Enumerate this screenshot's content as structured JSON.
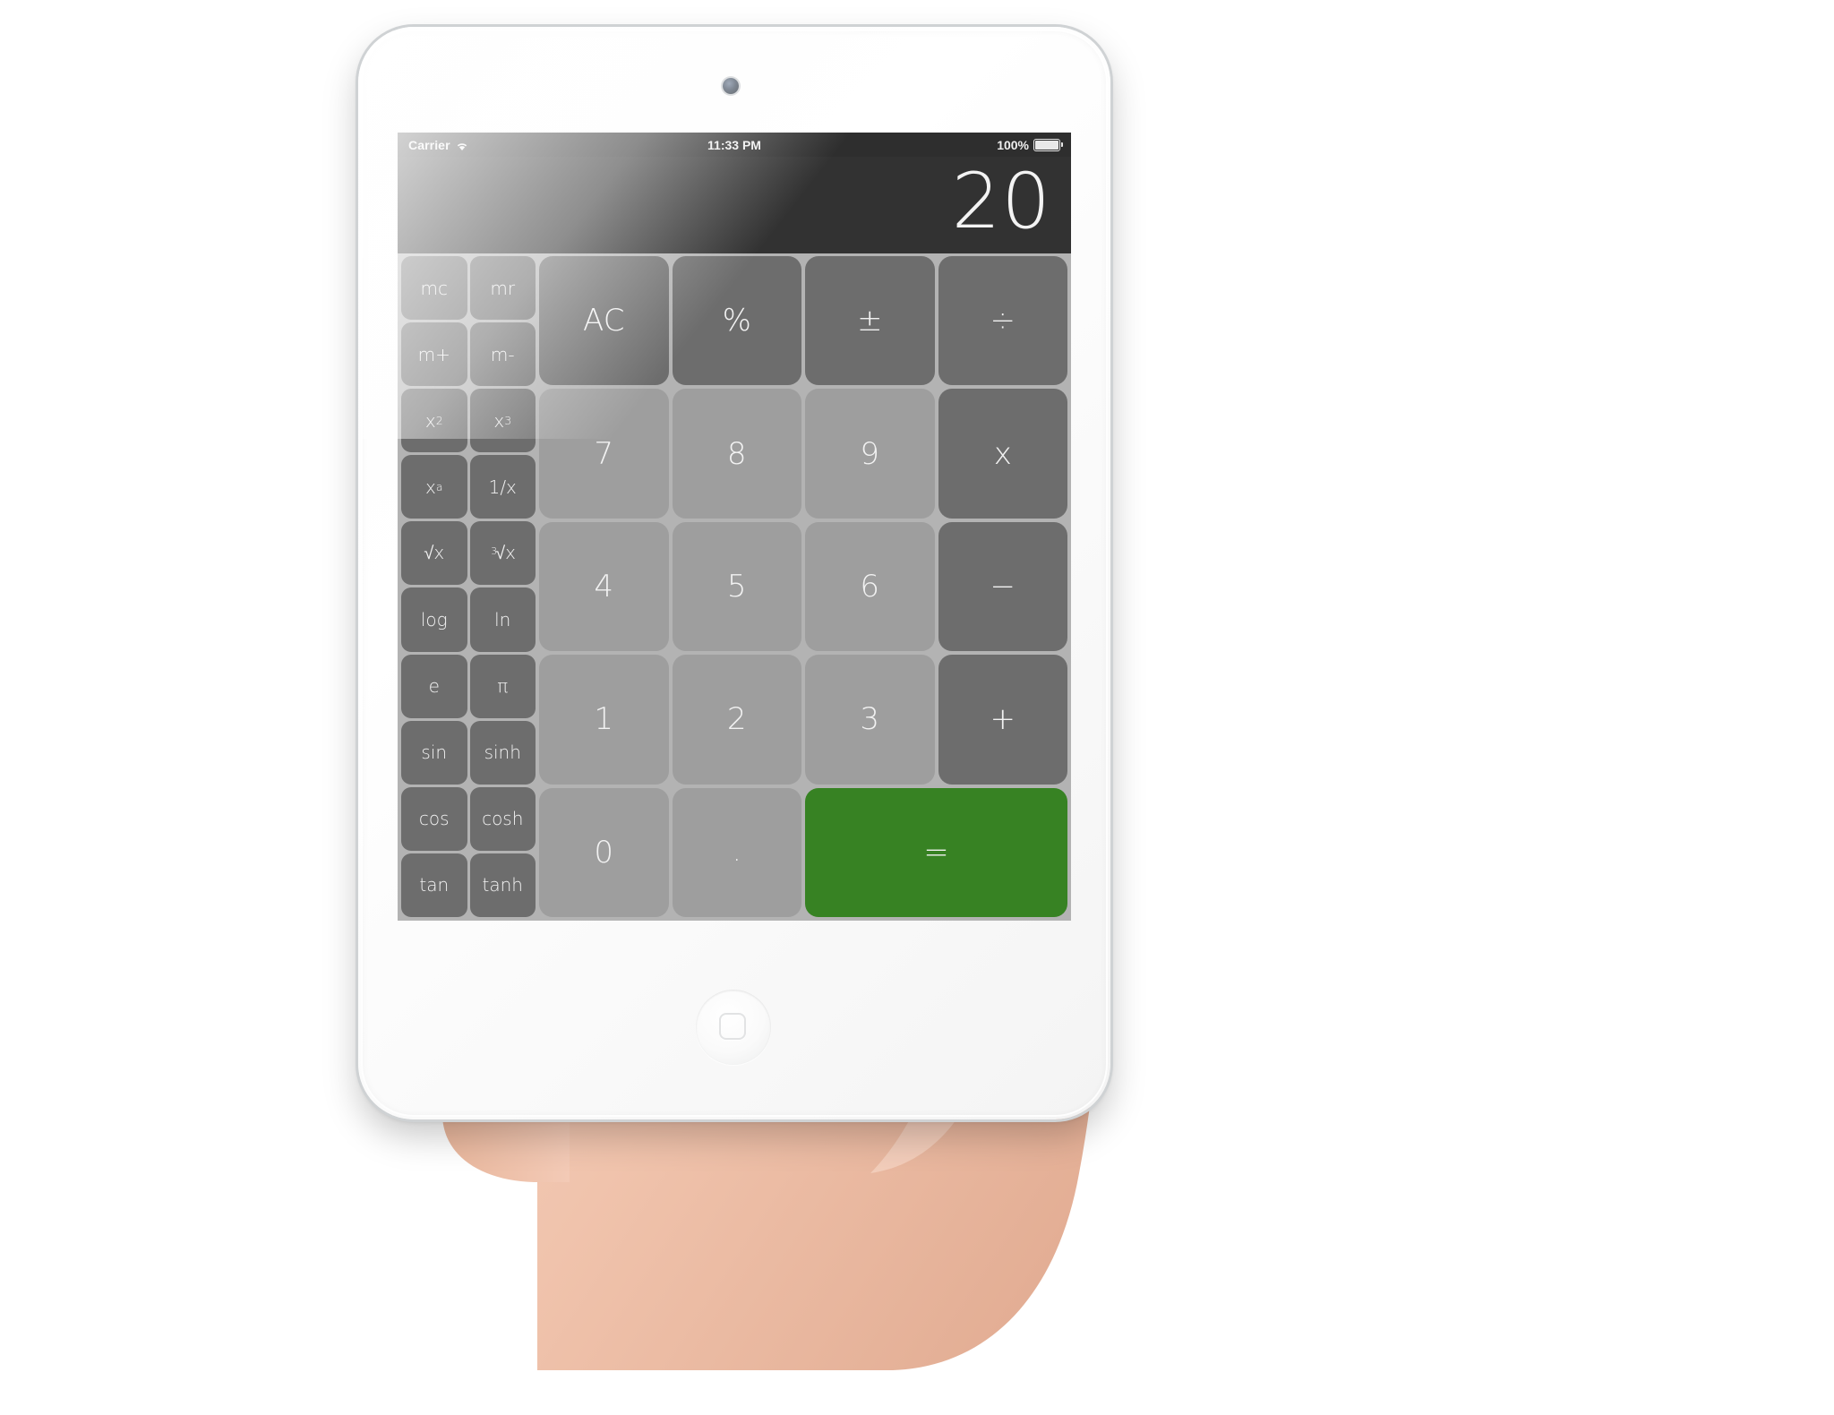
{
  "device": {
    "name": "white-tablet",
    "camera_icon": "front-camera",
    "home_button_icon": "home-button"
  },
  "statusbar": {
    "carrier": "Carrier",
    "wifi_icon": "wifi-icon",
    "time": "11:33 PM",
    "battery_percent": "100%",
    "battery_icon": "battery-full-icon"
  },
  "display": {
    "value": "20"
  },
  "colors": {
    "screen_background": "#b3b3b3",
    "display_background": "#323232",
    "statusbar_background": "#2e2e2e",
    "function_key": "#6d6d6d",
    "number_key": "#9e9e9e",
    "equals_key": "#378223",
    "key_label": "#f2f2f2"
  },
  "function_keys": [
    {
      "label": "mc",
      "name": "memory-clear"
    },
    {
      "label": "mr",
      "name": "memory-recall"
    },
    {
      "label": "m+",
      "name": "memory-add"
    },
    {
      "label": "m-",
      "name": "memory-subtract"
    },
    {
      "label": "x2",
      "name": "x-squared",
      "html": "x<sup>2</sup>"
    },
    {
      "label": "x3",
      "name": "x-cubed",
      "html": "x<sup>3</sup>"
    },
    {
      "label": "xa",
      "name": "x-power-a",
      "html": "x<sup>a</sup>"
    },
    {
      "label": "1/x",
      "name": "reciprocal"
    },
    {
      "label": "√x",
      "name": "square-root"
    },
    {
      "label": "3√x",
      "name": "cube-root",
      "html": "<span class=\"rad\"><span class=\"cbrt-idx\">3</span>√x</span>"
    },
    {
      "label": "log",
      "name": "log"
    },
    {
      "label": "ln",
      "name": "natural-log"
    },
    {
      "label": "e",
      "name": "euler-number"
    },
    {
      "label": "π",
      "name": "pi"
    },
    {
      "label": "sin",
      "name": "sine"
    },
    {
      "label": "sinh",
      "name": "hyperbolic-sine"
    },
    {
      "label": "cos",
      "name": "cosine"
    },
    {
      "label": "cosh",
      "name": "hyperbolic-cosine"
    },
    {
      "label": "tan",
      "name": "tangent"
    },
    {
      "label": "tanh",
      "name": "hyperbolic-tangent"
    }
  ],
  "main_keys": [
    {
      "label": "AC",
      "name": "all-clear",
      "type": "op"
    },
    {
      "label": "%",
      "name": "percent",
      "type": "op"
    },
    {
      "label": "±",
      "name": "plus-minus",
      "type": "op"
    },
    {
      "label": "÷",
      "name": "divide",
      "type": "op"
    },
    {
      "label": "7",
      "name": "digit-7",
      "type": "num"
    },
    {
      "label": "8",
      "name": "digit-8",
      "type": "num"
    },
    {
      "label": "9",
      "name": "digit-9",
      "type": "num"
    },
    {
      "label": "x",
      "name": "multiply",
      "type": "op"
    },
    {
      "label": "4",
      "name": "digit-4",
      "type": "num"
    },
    {
      "label": "5",
      "name": "digit-5",
      "type": "num"
    },
    {
      "label": "6",
      "name": "digit-6",
      "type": "num"
    },
    {
      "label": "−",
      "name": "subtract",
      "type": "op"
    },
    {
      "label": "1",
      "name": "digit-1",
      "type": "num"
    },
    {
      "label": "2",
      "name": "digit-2",
      "type": "num"
    },
    {
      "label": "3",
      "name": "digit-3",
      "type": "num"
    },
    {
      "label": "+",
      "name": "add",
      "type": "op"
    },
    {
      "label": "0",
      "name": "digit-0",
      "type": "num"
    },
    {
      "label": ".",
      "name": "decimal-point",
      "type": "num"
    },
    {
      "label": "=",
      "name": "equals",
      "type": "eq"
    }
  ]
}
